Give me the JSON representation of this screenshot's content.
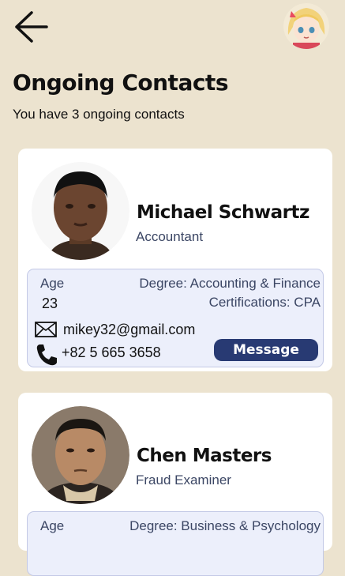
{
  "header": {
    "back_icon": "arrow-left-icon",
    "avatar_icon": "user-avatar-anime-icon"
  },
  "page": {
    "title": "Ongoing Contacts",
    "subtitle": "You have 3 ongoing contacts"
  },
  "contacts": [
    {
      "name": "Michael Schwartz",
      "role": "Accountant",
      "age_label": "Age",
      "age": "23",
      "degree": "Degree: Accounting & Finance",
      "certifications": "Certifications: CPA",
      "email": "mikey32@gmail.com",
      "phone": "+82 5 665 3658",
      "message_label": "Message"
    },
    {
      "name": "Chen Masters",
      "role": "Fraud Examiner",
      "age_label": "Age",
      "degree": "Degree: Business & Psychology"
    }
  ],
  "colors": {
    "background": "#ece3cf",
    "accent": "#283a73",
    "detail_bg": "#eceffb"
  }
}
